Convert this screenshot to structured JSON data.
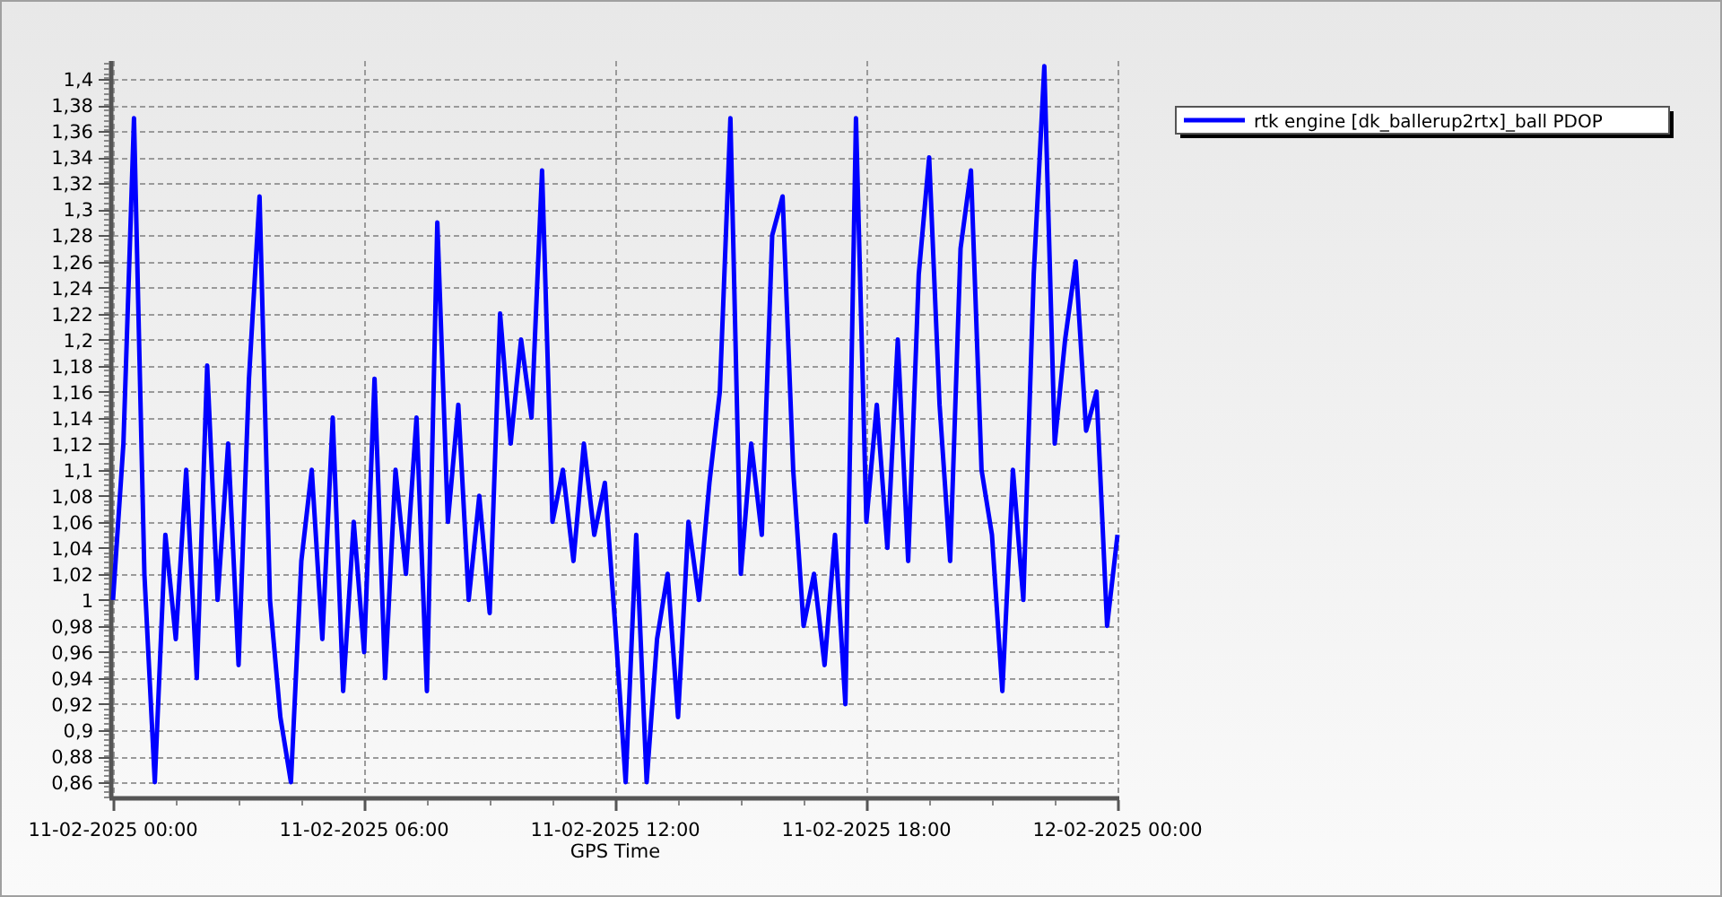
{
  "chart": {
    "chart_data": {
      "type": "line",
      "xlabel": "GPS Time",
      "categories": [
        "11-02-2025 00:00",
        null,
        null,
        null,
        null,
        null,
        null,
        null,
        null,
        null,
        null,
        null,
        null,
        null,
        null,
        null,
        null,
        null,
        null,
        null,
        null,
        null,
        null,
        null,
        "11-02-2025 06:00",
        null,
        null,
        null,
        null,
        null,
        null,
        null,
        null,
        null,
        null,
        null,
        null,
        null,
        null,
        null,
        null,
        null,
        null,
        null,
        null,
        null,
        null,
        null,
        "11-02-2025 12:00",
        null,
        null,
        null,
        null,
        null,
        null,
        null,
        null,
        null,
        null,
        null,
        null,
        null,
        null,
        null,
        null,
        null,
        null,
        null,
        null,
        null,
        null,
        null,
        "11-02-2025 18:00",
        null,
        null,
        null,
        null,
        null,
        null,
        null,
        null,
        null,
        null,
        null,
        null,
        null,
        null,
        null,
        null,
        null,
        null,
        null,
        null,
        null,
        null,
        null,
        "12-02-2025 00:00"
      ],
      "series": [
        {
          "name": "rtk engine [dk_ballerup2rtx]_ball PDOP",
          "color": "#0000ff",
          "values": [
            1.0,
            1.12,
            1.37,
            1.02,
            0.86,
            1.05,
            0.97,
            1.1,
            0.94,
            1.18,
            1.0,
            1.12,
            0.95,
            1.17,
            1.31,
            1.0,
            0.91,
            0.86,
            1.03,
            1.1,
            0.97,
            1.14,
            0.93,
            1.06,
            0.96,
            1.17,
            0.94,
            1.1,
            1.02,
            1.14,
            0.93,
            1.29,
            1.06,
            1.15,
            1.0,
            1.08,
            0.99,
            1.22,
            1.12,
            1.2,
            1.14,
            1.33,
            1.06,
            1.1,
            1.03,
            1.12,
            1.05,
            1.09,
            0.98,
            0.86,
            1.05,
            0.86,
            0.97,
            1.02,
            0.91,
            1.06,
            1.0,
            1.09,
            1.16,
            1.37,
            1.02,
            1.12,
            1.05,
            1.28,
            1.31,
            1.1,
            0.98,
            1.02,
            0.95,
            1.05,
            0.92,
            1.37,
            1.06,
            1.15,
            1.04,
            1.2,
            1.03,
            1.25,
            1.34,
            1.15,
            1.03,
            1.27,
            1.33,
            1.1,
            1.05,
            0.93,
            1.1,
            1.0,
            1.25,
            1.41,
            1.12,
            1.2,
            1.26,
            1.13,
            1.16,
            0.98,
            1.05
          ]
        }
      ],
      "grid": true,
      "ylim": [
        0.849,
        1.414
      ],
      "yticks": [
        {
          "value": 0.86,
          "label": "0,86"
        },
        {
          "value": 0.88,
          "label": "0,88"
        },
        {
          "value": 0.9,
          "label": "0,9"
        },
        {
          "value": 0.92,
          "label": "0,92"
        },
        {
          "value": 0.94,
          "label": "0,94"
        },
        {
          "value": 0.96,
          "label": "0,96"
        },
        {
          "value": 0.98,
          "label": "0,98"
        },
        {
          "value": 1,
          "label": "1"
        },
        {
          "value": 1.02,
          "label": "1,02"
        },
        {
          "value": 1.04,
          "label": "1,04"
        },
        {
          "value": 1.06,
          "label": "1,06"
        },
        {
          "value": 1.08,
          "label": "1,08"
        },
        {
          "value": 1.1,
          "label": "1,1"
        },
        {
          "value": 1.12,
          "label": "1,12"
        },
        {
          "value": 1.14,
          "label": "1,14"
        },
        {
          "value": 1.16,
          "label": "1,16"
        },
        {
          "value": 1.18,
          "label": "1,18"
        },
        {
          "value": 1.2,
          "label": "1,2"
        },
        {
          "value": 1.22,
          "label": "1,22"
        },
        {
          "value": 1.24,
          "label": "1,24"
        },
        {
          "value": 1.26,
          "label": "1,26"
        },
        {
          "value": 1.28,
          "label": "1,28"
        },
        {
          "value": 1.3,
          "label": "1,3"
        },
        {
          "value": 1.32,
          "label": "1,32"
        },
        {
          "value": 1.34,
          "label": "1,34"
        },
        {
          "value": 1.36,
          "label": "1,36"
        },
        {
          "value": 1.38,
          "label": "1,38"
        },
        {
          "value": 1.4,
          "label": "1,4"
        }
      ]
    }
  }
}
